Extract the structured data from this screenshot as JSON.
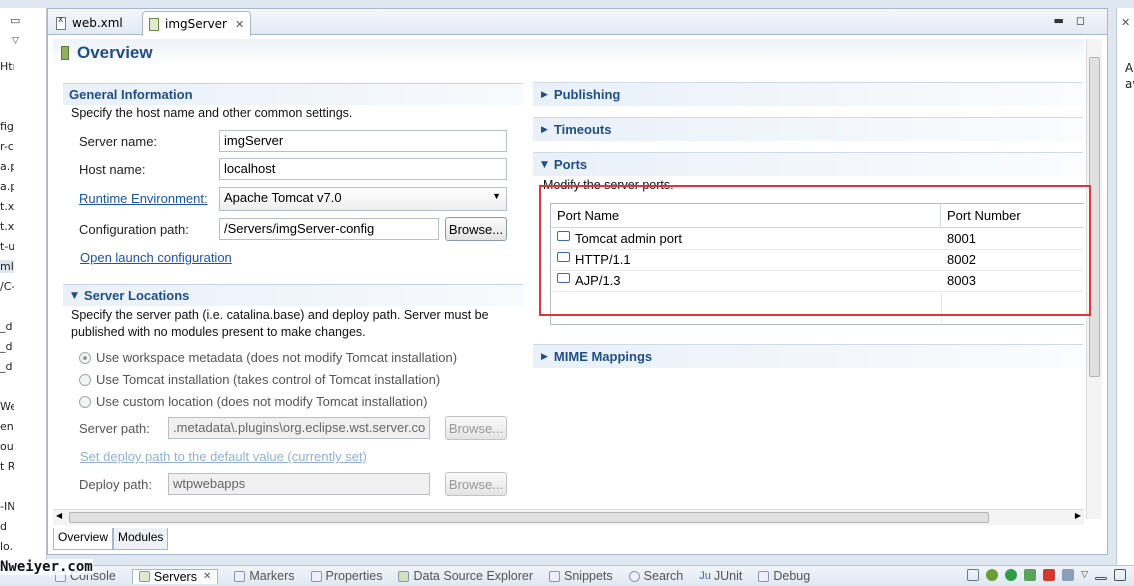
{
  "colors": {
    "accent": "#1f4e8a",
    "highlight_box": "#d9383a",
    "link": "#1a55a8"
  },
  "left_fragments": [
    "Htr",
    "fig",
    "r-c",
    "a.p",
    "a.p",
    "t.x",
    "t.xr",
    "t-u",
    "ml",
    "/C-",
    "_d",
    "_d",
    "_d",
    "We",
    "ent",
    "our",
    "t R",
    "-IN",
    "d",
    "lo.",
    "Nz"
  ],
  "tabs": [
    {
      "label": "web.xml",
      "icon": "xml-file-icon"
    },
    {
      "label": "imgServer",
      "icon": "server-icon"
    }
  ],
  "overview": {
    "title": "Overview"
  },
  "general": {
    "title": "General Information",
    "desc": "Specify the host name and other common settings.",
    "server_name_label": "Server name:",
    "server_name": "imgServer",
    "host_name_label": "Host name:",
    "host_name": "localhost",
    "runtime_label": "Runtime Environment:",
    "runtime": "Apache Tomcat v7.0",
    "config_label": "Configuration path:",
    "config_path": "/Servers/imgServer-config",
    "browse": "Browse...",
    "open_launch": "Open launch configuration"
  },
  "locations": {
    "title": "Server Locations",
    "desc1": "Specify the server path (i.e. catalina.base) and deploy path. Server must be",
    "desc2": "published with no modules present to make changes.",
    "radio1": "Use workspace metadata (does not modify Tomcat installation)",
    "radio2": "Use Tomcat installation (takes control of Tomcat installation)",
    "radio3": "Use custom location (does not modify Tomcat installation)",
    "server_path_label": "Server path:",
    "server_path": ".metadata\\.plugins\\org.eclipse.wst.server.co",
    "set_deploy": "Set deploy path to the default value (currently set)",
    "deploy_label": "Deploy path:",
    "deploy_path": "wtpwebapps",
    "browse": "Browse..."
  },
  "right": {
    "publishing": "Publishing",
    "timeouts": "Timeouts",
    "ports": "Ports",
    "ports_desc": "Modify the server ports.",
    "mime": "MIME Mappings",
    "col_name": "Port Name",
    "col_number": "Port Number",
    "rows": [
      {
        "name": "Tomcat admin port",
        "number": "8001"
      },
      {
        "name": "HTTP/1.1",
        "number": "8002"
      },
      {
        "name": "AJP/1.3",
        "number": "8003"
      }
    ]
  },
  "bottom_tabs": [
    "Overview",
    "Modules"
  ],
  "right_strip": "A\nav",
  "views": [
    "Console",
    "Servers",
    "Markers",
    "Properties",
    "Data Source Explorer",
    "Snippets",
    "Search",
    "JUnit",
    "Debug"
  ],
  "watermark": "Nweiyer.com"
}
